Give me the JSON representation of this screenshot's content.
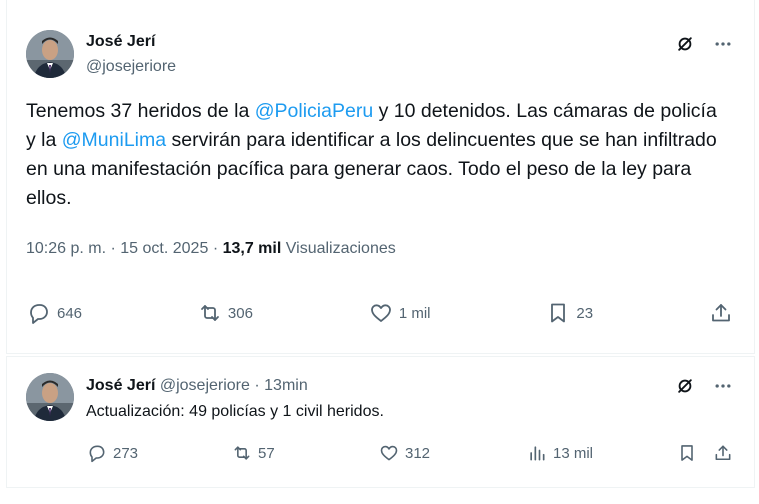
{
  "main_post": {
    "author_name": "José Jerí",
    "author_handle": "@josejeriore",
    "text_part1": "Tenemos 37 heridos de la ",
    "mention1": "@PoliciaPeru",
    "text_part2": " y 10 detenidos. Las cámaras de policía y la ",
    "mention2": "@MuniLima",
    "text_part3": " servirán para identificar a los delincuentes que se han infiltrado en una manifestación pacífica para generar caos. Todo el peso de la ley para ellos.",
    "time": "10:26 p. m.",
    "date": "15 oct. 2025",
    "separator": "·",
    "views_count": "13,7 mil",
    "views_label": "Visualizaciones",
    "replies": "646",
    "reposts": "306",
    "likes": "1 mil",
    "bookmarks": "23"
  },
  "reply_post": {
    "author_name": "José Jerí",
    "author_handle": "@josejeriore",
    "separator": "·",
    "age": "13min",
    "text": "Actualización: 49 policías y 1 civil heridos.",
    "replies": "273",
    "reposts": "57",
    "likes": "312",
    "views": "13 mil"
  },
  "colors": {
    "mention": "#1d9bf0",
    "secondary_text": "#536471",
    "primary_text": "#0f1419"
  },
  "icons": [
    "grok-icon",
    "more-icon",
    "reply-icon",
    "repost-icon",
    "like-icon",
    "bookmark-icon",
    "share-icon",
    "views-icon"
  ]
}
